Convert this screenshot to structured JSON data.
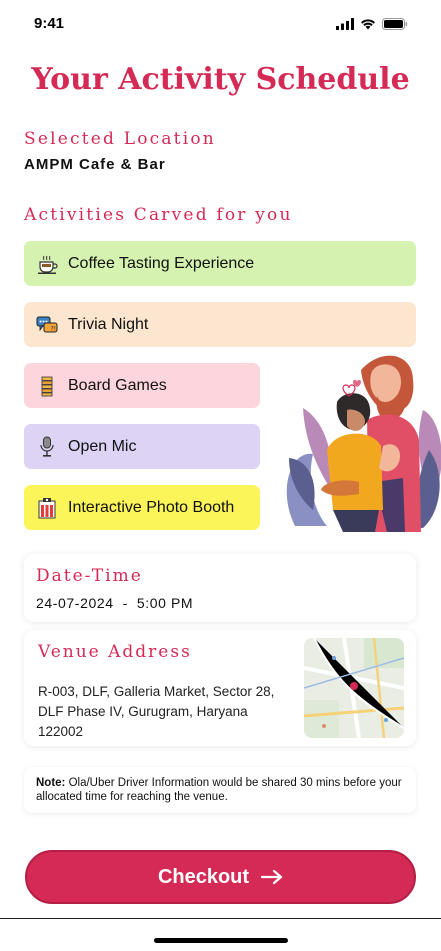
{
  "status_bar": {
    "time": "9:41"
  },
  "page": {
    "title": "Your Activity Schedule"
  },
  "location": {
    "label": "Selected Location",
    "name": "AMPM Cafe & Bar"
  },
  "activities": {
    "label": "Activities Carved for you",
    "items": [
      {
        "label": "Coffee Tasting Experience",
        "icon": "coffee-cup-icon",
        "color": "#d5f2b0"
      },
      {
        "label": "Trivia Night",
        "icon": "chat-bubbles-icon",
        "color": "#fde6cf"
      },
      {
        "label": "Board Games",
        "icon": "jenga-blocks-icon",
        "color": "#fdd6dd"
      },
      {
        "label": "Open Mic",
        "icon": "microphone-icon",
        "color": "#ddd3f5"
      },
      {
        "label": "Interactive Photo Booth",
        "icon": "photo-booth-icon",
        "color": "#fbf55a"
      }
    ]
  },
  "datetime": {
    "label": "Date-Time",
    "value": "24-07-2024  -  5:00 PM"
  },
  "venue": {
    "label": "Venue Address",
    "address": "R-003, DLF, Galleria Market, Sector 28, DLF Phase IV, Gurugram, Haryana 122002"
  },
  "note": {
    "prefix": "Note:",
    "text": " Ola/Uber Driver Information would be shared 30 mins before your allocated time for reaching the venue."
  },
  "checkout": {
    "label": "Checkout"
  },
  "colors": {
    "accent": "#d42a55"
  }
}
